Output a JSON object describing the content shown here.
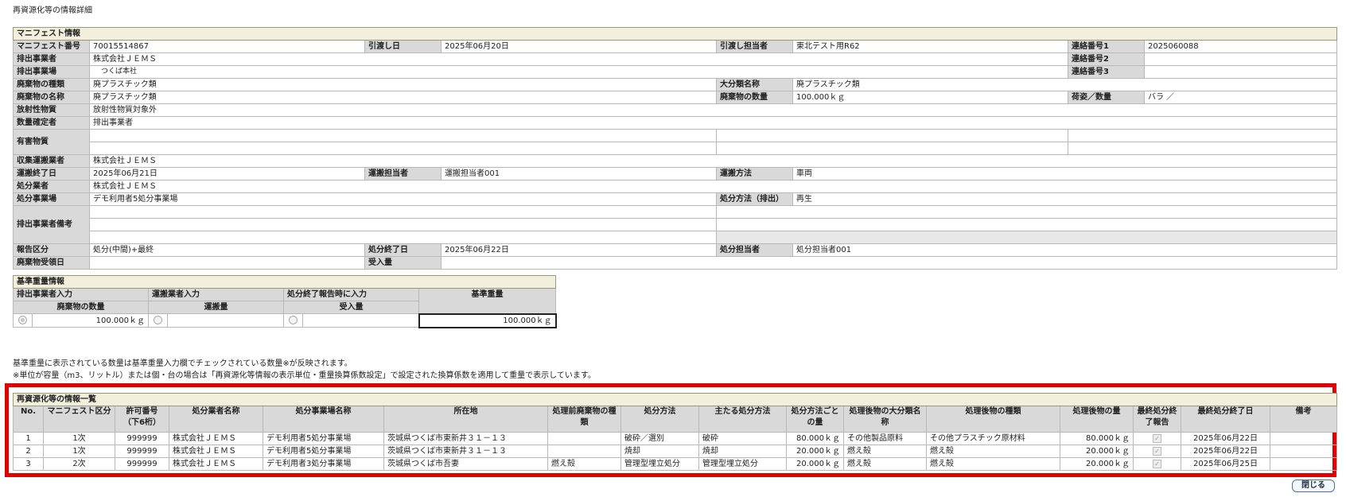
{
  "page_title": "再資源化等の情報詳細",
  "manifest": {
    "section_title": "マニフェスト情報",
    "manifest_no_label": "マニフェスト番号",
    "manifest_no": "70015514867",
    "delivery_date_label": "引渡し日",
    "delivery_date": "2025年06月20日",
    "delivery_person_label": "引渡し担当者",
    "delivery_person": "東北テスト用R62",
    "contact1_label": "連絡番号1",
    "contact1": "2025060088",
    "emitter_label": "排出事業者",
    "emitter": "株式会社ＪＥＭＳ",
    "contact2_label": "連絡番号2",
    "contact2": "",
    "site_label": "排出事業場",
    "site": "つくば本社",
    "contact3_label": "連絡番号3",
    "contact3": "",
    "waste_type_label": "廃棄物の種類",
    "waste_type": "廃プラスチック類",
    "major_class_label": "大分類名称",
    "major_class": "廃プラスチック類",
    "waste_name_label": "廃棄物の名称",
    "waste_name": "廃プラスチック類",
    "waste_qty_label": "廃棄物の数量",
    "waste_qty": "100.000ｋｇ",
    "packing_label": "荷姿／数量",
    "packing": "バラ ／",
    "radioactive_label": "放射性物質",
    "radioactive": "放射性物質対象外",
    "qty_fixer_label": "数量確定者",
    "qty_fixer": "排出事業者",
    "hazardous_label": "有害物質",
    "collector_label": "収集運搬業者",
    "collector": "株式会社ＪＥＭＳ",
    "transport_end_label": "運搬終了日",
    "transport_end": "2025年06月21日",
    "transport_person_label": "運搬担当者",
    "transport_person": "運搬担当者001",
    "transport_method_label": "運搬方法",
    "transport_method": "車両",
    "disposer_label": "処分業者",
    "disposer": "株式会社ＪＥＭＳ",
    "disposal_site_label": "処分事業場",
    "disposal_site": "デモ利用者5処分事業場",
    "disposal_method_label": "処分方法（排出）",
    "disposal_method": "再生",
    "emitter_remarks_label": "排出事業者備考",
    "report_type_label": "報告区分",
    "report_type": "処分(中間)+最終",
    "disposal_end_label": "処分終了日",
    "disposal_end": "2025年06月22日",
    "disposal_person_label": "処分担当者",
    "disposal_person": "処分担当者001",
    "receipt_date_label": "廃棄物受領日",
    "receipt_date": "",
    "received_qty_label": "受入量",
    "received_qty": ""
  },
  "weight": {
    "section_title": "基準重量情報",
    "emitter_input": "排出事業者入力",
    "collector_input": "運搬業者入力",
    "disposal_input": "処分終了報告時に入力",
    "base_weight_label": "基準重量",
    "waste_qty_label": "廃棄物の数量",
    "transport_qty_label": "運搬量",
    "received_qty_label": "受入量",
    "waste_qty": "100.000ｋｇ",
    "transport_qty": "",
    "received_qty": "",
    "base_weight": "100.000ｋｇ"
  },
  "notes": {
    "note1": "基準重量に表示されている数量は基準重量入力欄でチェックされている数量※が反映されます。",
    "note2": "※単位が容量（m3、リットル）または個・台の場合は「再資源化等情報の表示単位・重量換算係数設定」で設定された換算係数を適用して重量で表示しています。"
  },
  "recycle": {
    "section_title": "再資源化等の情報一覧",
    "headers": [
      "No.",
      "マニフェスト区分",
      "許可番号（下6桁）",
      "処分業者名称",
      "処分事業場名称",
      "所在地",
      "処理前廃棄物の種類",
      "処分方法",
      "主たる処分方法",
      "処分方法ごとの量",
      "処理後物の大分類名称",
      "処理後物の種類",
      "処理後物の量",
      "最終処分終了報告",
      "最終処分終了日",
      "備考"
    ],
    "rows": [
      [
        "1",
        "1次",
        "999999",
        "株式会社ＪＥＭＳ",
        "デモ利用者5処分事業場",
        "茨城県つくば市東新井３１－１３",
        "",
        "破砕／選別",
        "破砕",
        "80.000ｋｇ",
        "その他製品原料",
        "その他プラスチック原材料",
        "80.000ｋｇ",
        "",
        "2025年06月22日",
        ""
      ],
      [
        "2",
        "1次",
        "999999",
        "株式会社ＪＥＭＳ",
        "デモ利用者5処分事業場",
        "茨城県つくば市東新井３１－１３",
        "",
        "焼却",
        "焼却",
        "20.000ｋｇ",
        "燃え殻",
        "燃え殻",
        "20.000ｋｇ",
        "",
        "2025年06月22日",
        ""
      ],
      [
        "3",
        "2次",
        "999999",
        "株式会社ＪＥＭＳ",
        "デモ利用者3処分事業場",
        "茨城県つくば市吾妻",
        "燃え殻",
        "管理型埋立処分",
        "管理型埋立処分",
        "20.000ｋｇ",
        "燃え殻",
        "燃え殻",
        "20.000ｋｇ",
        "",
        "2025年06月25日",
        ""
      ]
    ]
  },
  "close_button": "閉じる"
}
